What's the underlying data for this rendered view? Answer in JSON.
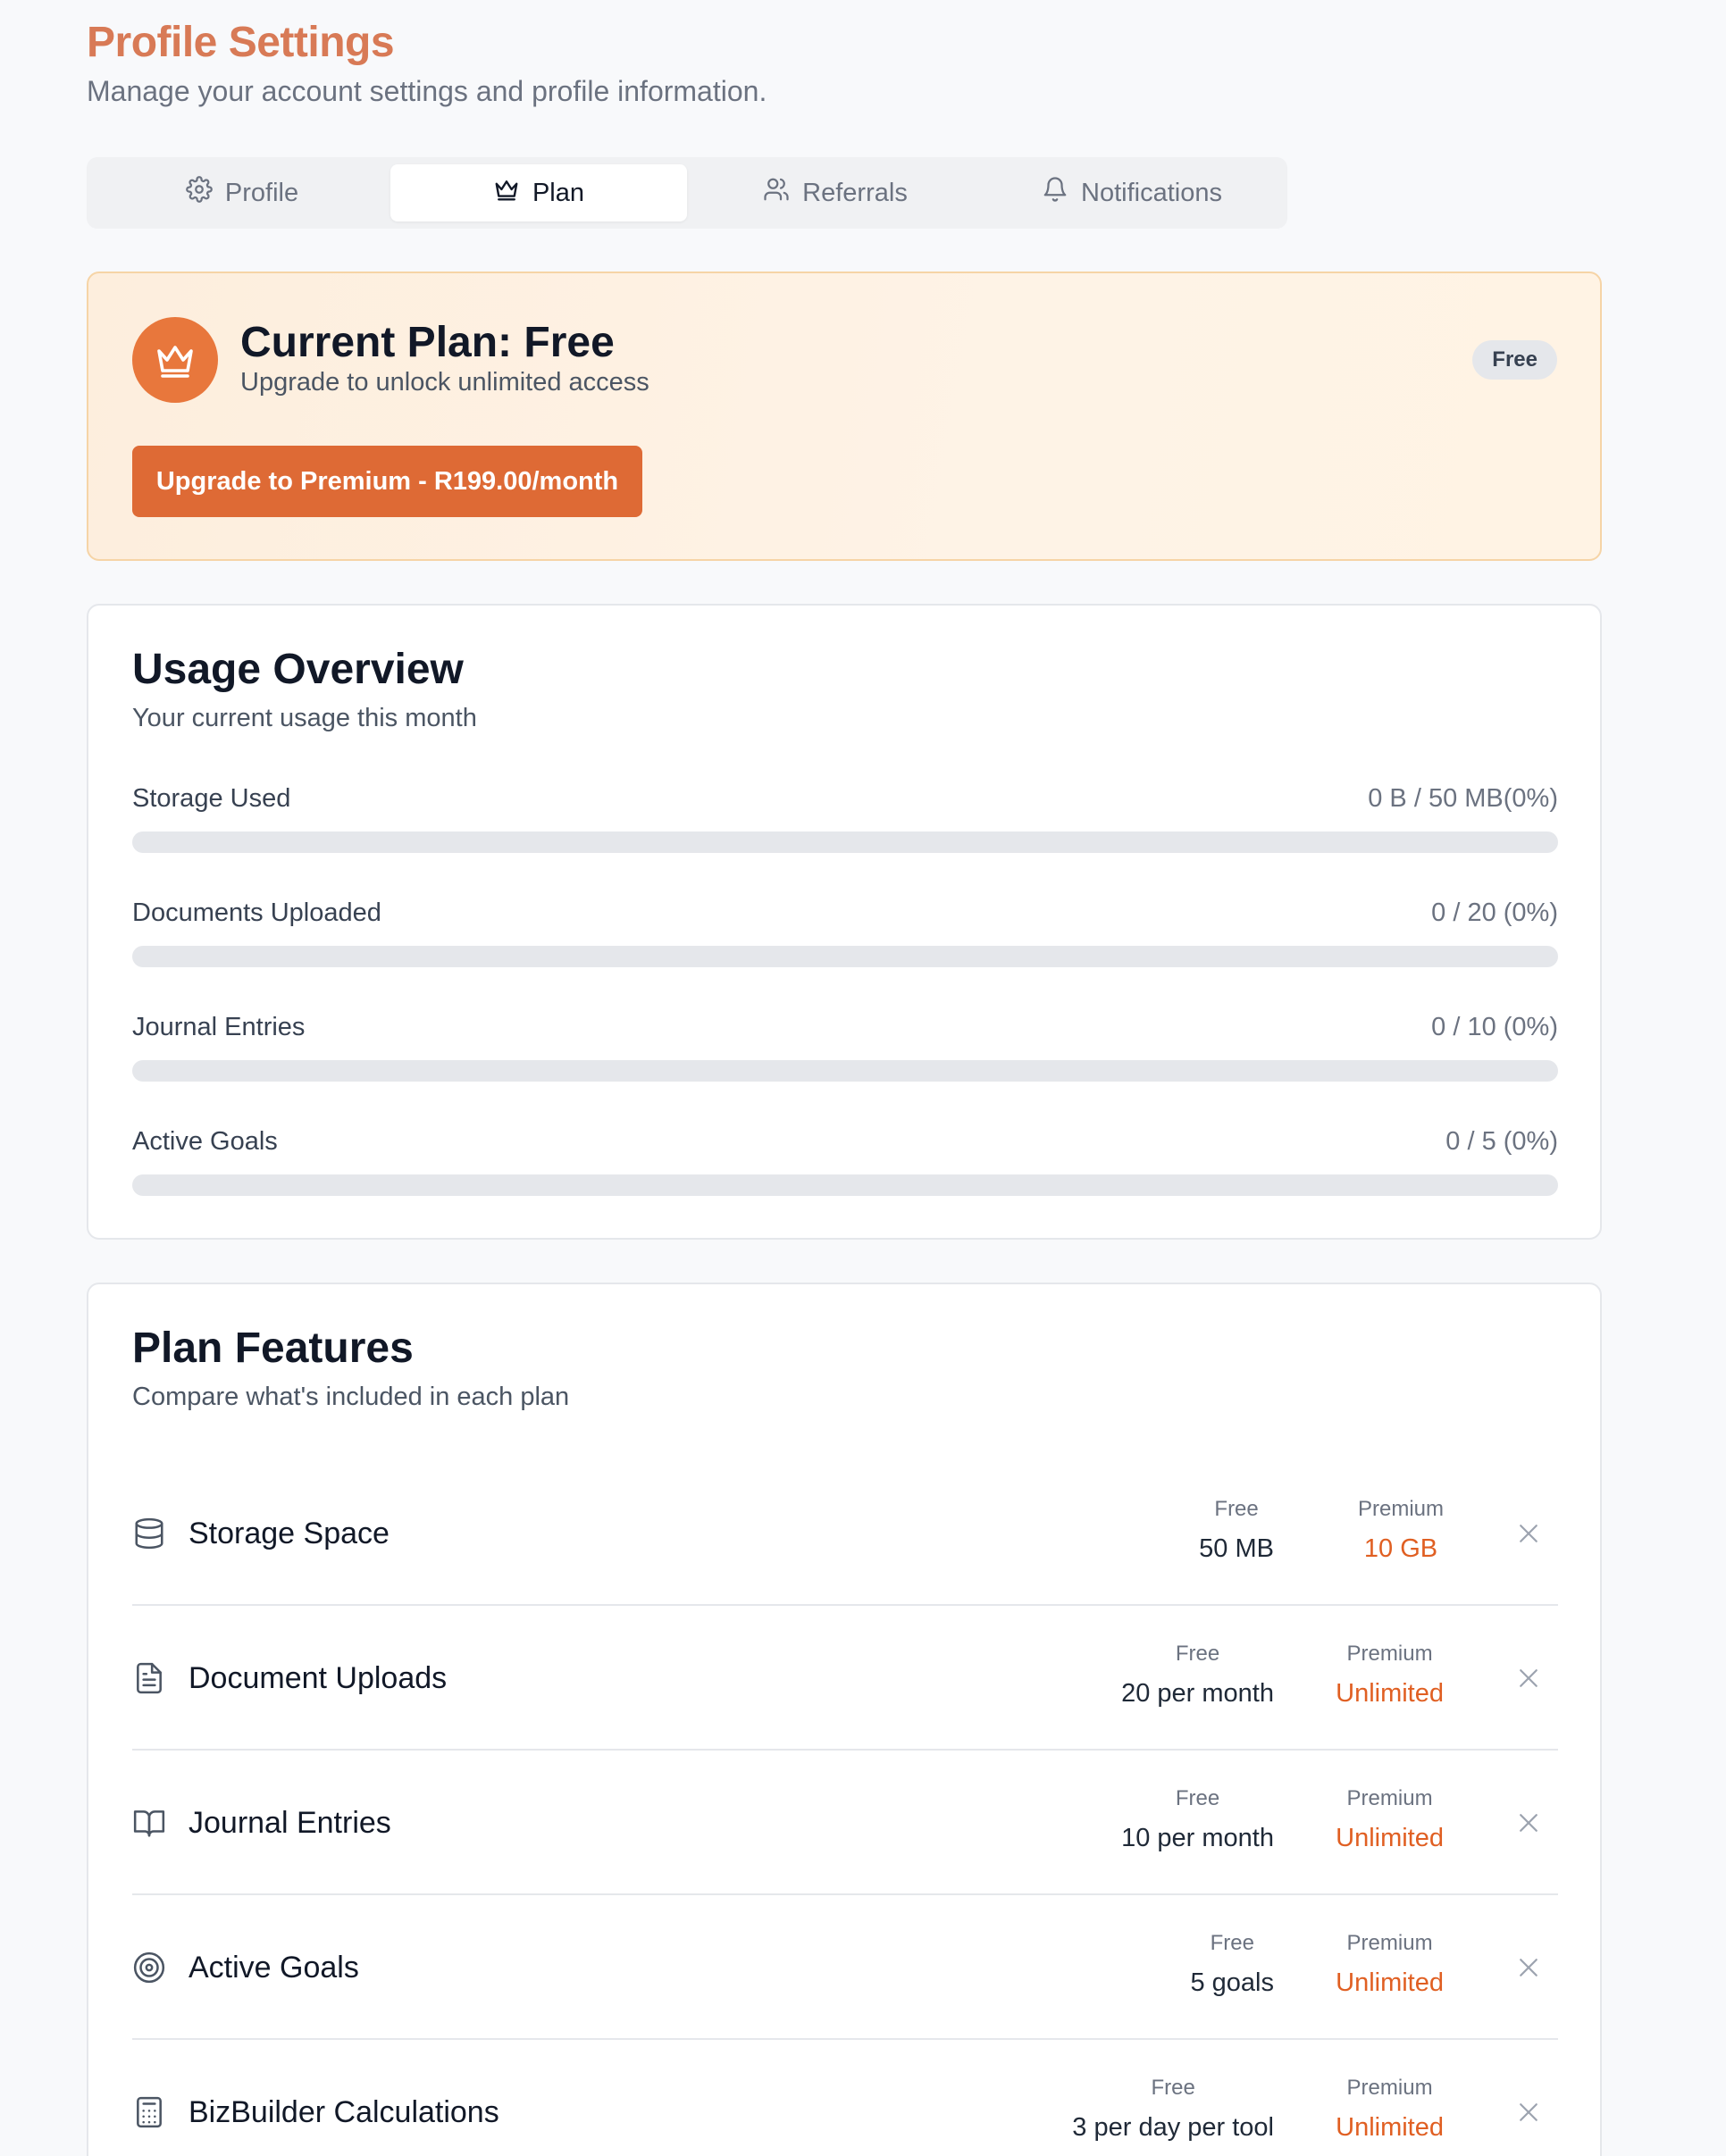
{
  "header": {
    "title": "Profile Settings",
    "subtitle": "Manage your account settings and profile information."
  },
  "tabs": [
    {
      "label": "Profile",
      "icon": "gear-icon",
      "active": false
    },
    {
      "label": "Plan",
      "icon": "crown-icon",
      "active": true
    },
    {
      "label": "Referrals",
      "icon": "users-icon",
      "active": false
    },
    {
      "label": "Notifications",
      "icon": "bell-icon",
      "active": false
    }
  ],
  "current_plan": {
    "title": "Current Plan: Free",
    "subtitle": "Upgrade to unlock unlimited access",
    "badge": "Free",
    "upgrade_label": "Upgrade to Premium - R199.00/month",
    "icon": "crown-icon"
  },
  "usage": {
    "title": "Usage Overview",
    "subtitle": "Your current usage this month",
    "items": [
      {
        "label": "Storage Used",
        "value": "0 B / 50 MB(0%)",
        "progress": 0
      },
      {
        "label": "Documents Uploaded",
        "value": "0 / 20 (0%)",
        "progress": 0
      },
      {
        "label": "Journal Entries",
        "value": "0 / 10 (0%)",
        "progress": 0
      },
      {
        "label": "Active Goals",
        "value": "0 / 5 (0%)",
        "progress": 0
      }
    ]
  },
  "features": {
    "title": "Plan Features",
    "subtitle": "Compare what's included in each plan",
    "free_header": "Free",
    "premium_header": "Premium",
    "items": [
      {
        "name": "Storage Space",
        "icon": "database-icon",
        "free": "50 MB",
        "premium": "10 GB"
      },
      {
        "name": "Document Uploads",
        "icon": "document-icon",
        "free": "20 per month",
        "premium": "Unlimited"
      },
      {
        "name": "Journal Entries",
        "icon": "book-open-icon",
        "free": "10 per month",
        "premium": "Unlimited"
      },
      {
        "name": "Active Goals",
        "icon": "target-icon",
        "free": "5 goals",
        "premium": "Unlimited"
      },
      {
        "name": "BizBuilder Calculations",
        "icon": "calculator-icon",
        "free": "3 per day per tool",
        "premium": "Unlimited"
      }
    ]
  },
  "colors": {
    "title_accent": "#d87a56",
    "primary": "#de6a35",
    "premium_value": "#e05f22"
  }
}
